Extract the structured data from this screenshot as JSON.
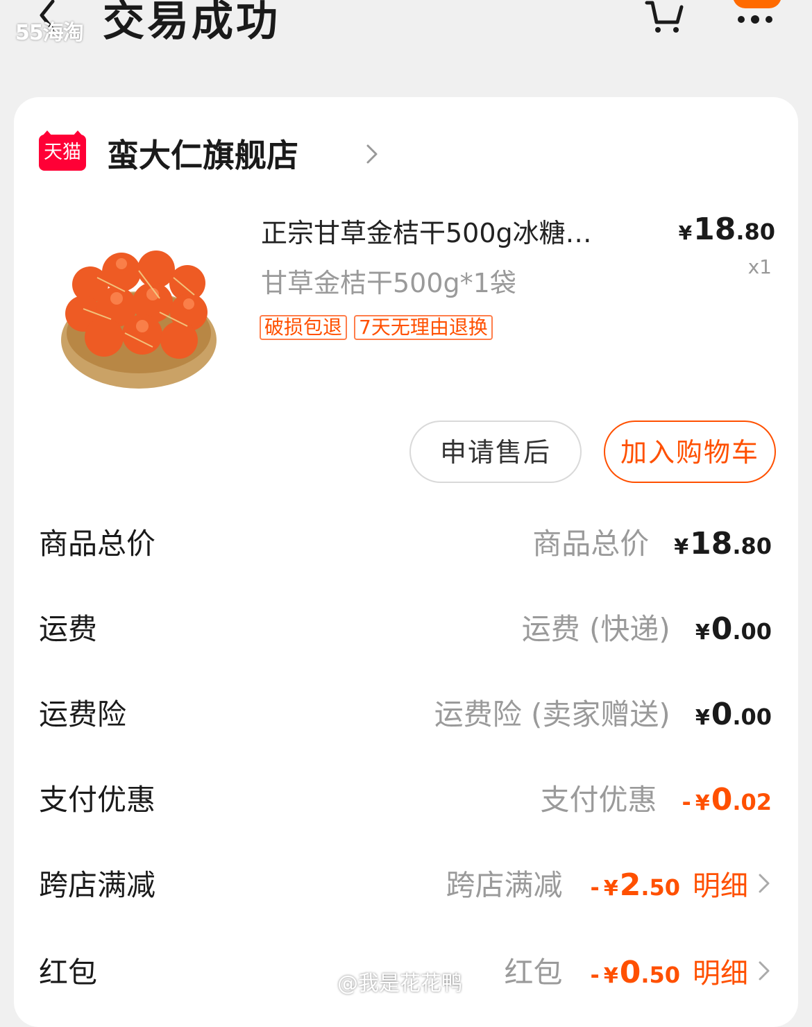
{
  "header": {
    "title": "交易成功",
    "watermark": "55海淘"
  },
  "shop": {
    "badge": "天猫",
    "name": "蛮大仁旗舰店"
  },
  "product": {
    "title": "正宗甘草金桔干500g冰糖…",
    "sku": "甘草金桔干500g*1袋",
    "price": {
      "currency": "¥",
      "int": "18",
      "dec": ".80"
    },
    "quantity": "x1",
    "tags": [
      "破损包退",
      "7天无理由退换"
    ]
  },
  "actions": {
    "after_sale": "申请售后",
    "add_to_cart": "加入购物车"
  },
  "fees": [
    {
      "label": "商品总价",
      "sub": "商品总价",
      "sign": "",
      "currency": "¥",
      "int": "18",
      "dec": ".80",
      "detail": ""
    },
    {
      "label": "运费",
      "sub": "运费 (快递)",
      "sign": "",
      "currency": "¥",
      "int": "0",
      "dec": ".00",
      "detail": ""
    },
    {
      "label": "运费险",
      "sub": "运费险 (卖家赠送)",
      "sign": "",
      "currency": "¥",
      "int": "0",
      "dec": ".00",
      "detail": ""
    },
    {
      "label": "支付优惠",
      "sub": "支付优惠",
      "sign": "-",
      "currency": "¥",
      "int": "0",
      "dec": ".02",
      "detail": ""
    },
    {
      "label": "跨店满减",
      "sub": "跨店满减",
      "sign": "-",
      "currency": "¥",
      "int": "2",
      "dec": ".50",
      "detail": "明细"
    },
    {
      "label": "红包",
      "sub": "红包",
      "sign": "-",
      "currency": "¥",
      "int": "0",
      "dec": ".50",
      "detail": "明细"
    }
  ],
  "watermark_bottom": "@我是花花鸭",
  "colors": {
    "accent": "#ff5000",
    "tmall": "#ff0036"
  }
}
